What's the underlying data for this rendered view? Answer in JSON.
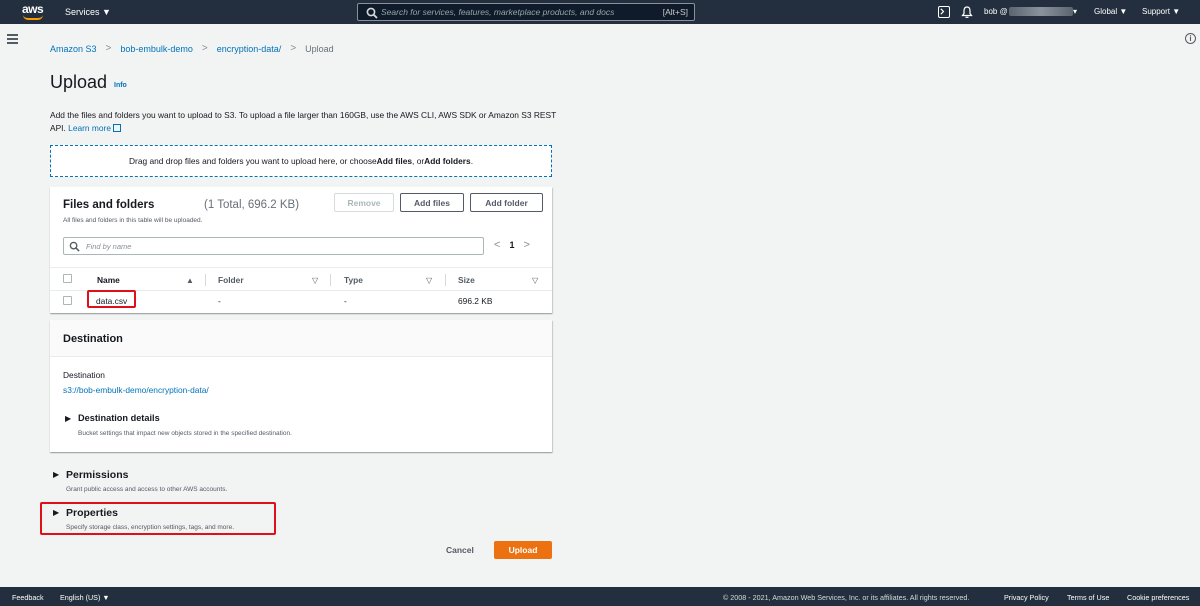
{
  "topnav": {
    "logo_text": "aws",
    "services_label": "Services ▼",
    "search_placeholder": "Search for services, features, marketplace products, and docs",
    "search_shortcut": "[Alt+S]",
    "user_label": "bob @",
    "user_caret": "▾",
    "region_label": "Global ▼",
    "support_label": "Support ▼"
  },
  "breadcrumb": {
    "items": [
      "Amazon S3",
      "bob-embulk-demo",
      "encryption-data/"
    ],
    "current": "Upload"
  },
  "header": {
    "title": "Upload",
    "info_label": "Info",
    "description": "Add the files and folders you want to upload to S3. To upload a file larger than 160GB, use the AWS CLI, AWS SDK or Amazon S3 REST API.",
    "learn_more": "Learn more"
  },
  "dropzone": {
    "text_before": "Drag and drop files and folders you want to upload here, or choose ",
    "add_files": "Add files",
    "text_mid": ", or ",
    "add_folders": "Add folders",
    "text_after": "."
  },
  "files": {
    "title": "Files and folders",
    "count": "(1 Total, 696.2 KB)",
    "subtitle": "All files and folders in this table will be uploaded.",
    "remove_label": "Remove",
    "add_files_label": "Add files",
    "add_folder_label": "Add folder",
    "find_placeholder": "Find by name",
    "page": "1",
    "columns": [
      "Name",
      "Folder",
      "Type",
      "Size"
    ],
    "rows": [
      {
        "name": "data.csv",
        "folder": "-",
        "type": "-",
        "size": "696.2 KB"
      }
    ]
  },
  "destination": {
    "title": "Destination",
    "label": "Destination",
    "uri": "s3://bob-embulk-demo/encryption-data/",
    "details_title": "Destination details",
    "details_sub": "Bucket settings that impact new objects stored in the specified destination."
  },
  "permissions": {
    "title": "Permissions",
    "sub": "Grant public access and access to other AWS accounts."
  },
  "properties": {
    "title": "Properties",
    "sub": "Specify storage class, encryption settings, tags, and more."
  },
  "actions": {
    "cancel": "Cancel",
    "upload": "Upload"
  },
  "footer": {
    "feedback": "Feedback",
    "language": "English (US) ▼",
    "copyright": "© 2008 - 2021, Amazon Web Services, Inc. or its affiliates. All rights reserved.",
    "privacy": "Privacy Policy",
    "terms": "Terms of Use",
    "cookies": "Cookie preferences"
  },
  "colors": {
    "nav_bg": "#232f3e",
    "link": "#0073bb",
    "primary_button": "#ec7211",
    "highlight_box": "#e0101a"
  }
}
